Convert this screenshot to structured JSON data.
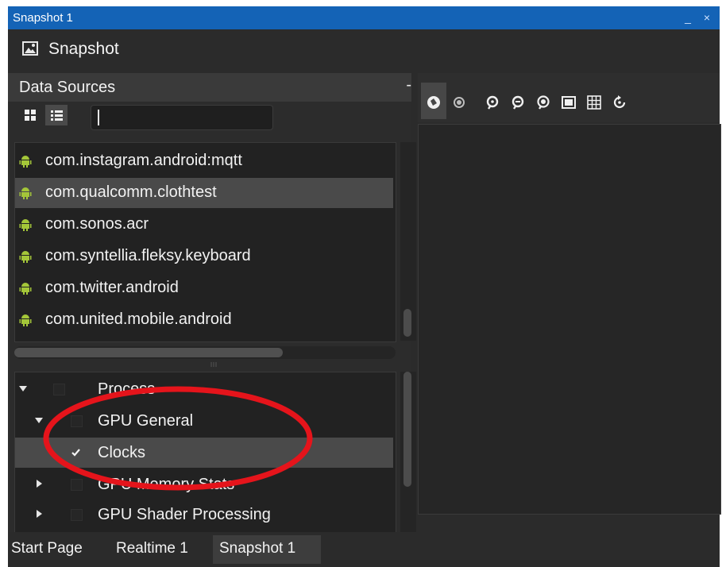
{
  "window": {
    "title": "Snapshot 1",
    "controls": "_ ×"
  },
  "toolbar": {
    "icon": "image-icon",
    "label": "Snapshot"
  },
  "data_sources": {
    "title": "Data Sources",
    "minimize": "-",
    "view_buttons": [
      "grid-view-icon",
      "list-view-icon"
    ],
    "search": {
      "value": "",
      "placeholder": ""
    },
    "items": [
      {
        "icon": "android-icon",
        "label": "com.instagram.android:mqtt",
        "selected": false
      },
      {
        "icon": "android-icon",
        "label": "com.qualcomm.clothtest",
        "selected": true
      },
      {
        "icon": "android-icon",
        "label": "com.sonos.acr",
        "selected": false
      },
      {
        "icon": "android-icon",
        "label": "com.syntellia.fleksy.keyboard",
        "selected": false
      },
      {
        "icon": "android-icon",
        "label": "com.twitter.android",
        "selected": false
      },
      {
        "icon": "android-icon",
        "label": "com.united.mobile.android",
        "selected": false
      }
    ]
  },
  "metrics_tree": {
    "rows": [
      {
        "label": "Process",
        "expanded": true,
        "checked": false,
        "level": 0
      },
      {
        "label": "GPU General",
        "expanded": true,
        "checked": false,
        "level": 1
      },
      {
        "label": "Clocks",
        "expanded": null,
        "checked": true,
        "level": 2,
        "selected": true
      },
      {
        "label": "GPU Memory Stats",
        "expanded": false,
        "checked": false,
        "level": 1
      },
      {
        "label": "GPU Shader Processing",
        "expanded": false,
        "checked": false,
        "level": 1
      }
    ]
  },
  "view_toolbar": {
    "buttons": [
      "capture-icon",
      "record-icon",
      "zoom-in-icon",
      "zoom-out-icon",
      "zoom-reset-icon",
      "fill-icon",
      "grid-icon",
      "refresh-icon"
    ]
  },
  "tabs": [
    {
      "label": "Start Page",
      "active": false
    },
    {
      "label": "Realtime 1",
      "active": false
    },
    {
      "label": "Snapshot 1",
      "active": true
    }
  ],
  "annotation": {
    "color": "#e5141b"
  },
  "colors": {
    "title_bar": "#1463b6",
    "android_green": "#a4c639",
    "selection": "#4a4a4a"
  }
}
